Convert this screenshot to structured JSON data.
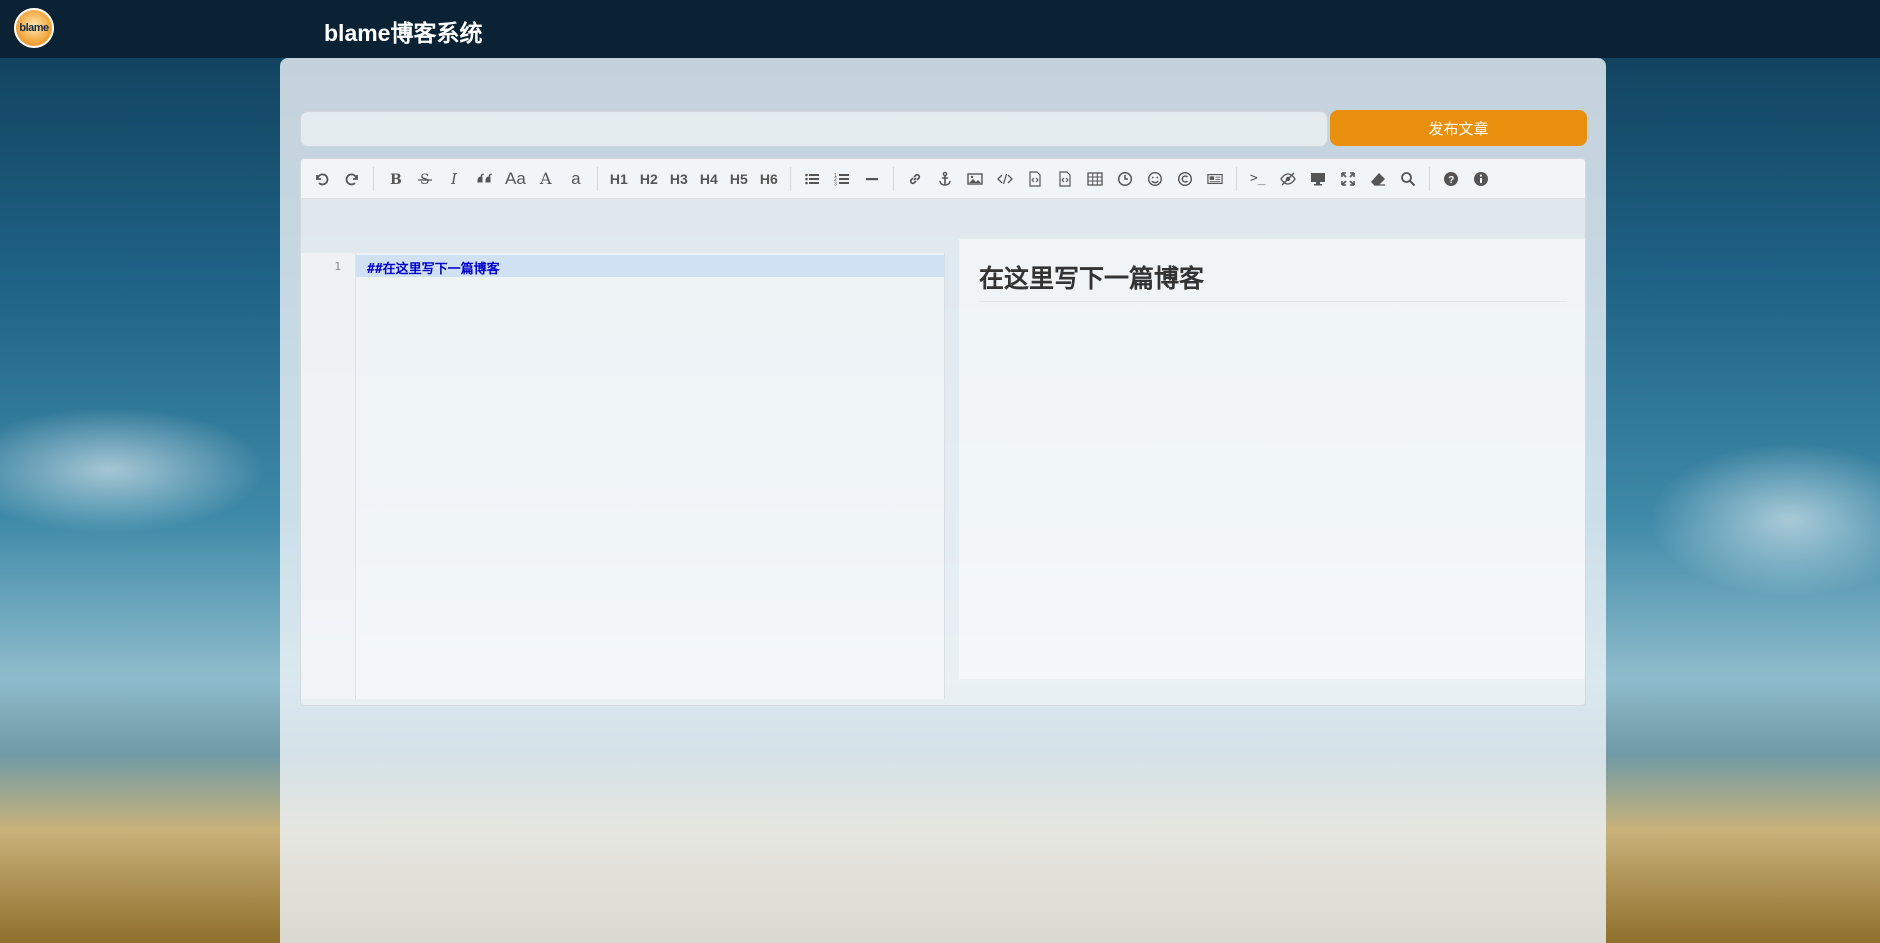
{
  "site": {
    "logo_text": "blame",
    "title": "blame博客系统"
  },
  "form": {
    "title_value": "",
    "publish_label": "发布文章"
  },
  "toolbar": {
    "groups": [
      [
        "undo-icon",
        "redo-icon"
      ],
      [
        "bold-icon",
        "strikethrough-icon",
        "italic-icon",
        "quote-icon",
        "uppercase-icon",
        "uppercase-first-icon",
        "lowercase-icon"
      ],
      [
        "H1",
        "H2",
        "H3",
        "H4",
        "H5",
        "H6"
      ],
      [
        "unordered-list-icon",
        "ordered-list-icon",
        "horizontal-rule-icon"
      ],
      [
        "link-icon",
        "anchor-icon",
        "image-icon",
        "code-icon",
        "preformatted-code-icon",
        "code-block-icon",
        "table-icon",
        "datetime-icon",
        "emoji-icon",
        "html-entities-icon",
        "pagebreak-icon"
      ],
      [
        "goto-line-icon",
        "watch-icon",
        "preview-icon",
        "fullscreen-icon",
        "clear-icon",
        "search-icon"
      ],
      [
        "help-icon",
        "info-icon"
      ]
    ],
    "heading_labels": [
      "H1",
      "H2",
      "H3",
      "H4",
      "H5",
      "H6"
    ],
    "aa_label": "Aa",
    "a_upper_label": "A",
    "a_lower_label": "a",
    "goto_label": ">_"
  },
  "editor": {
    "line_number": "1",
    "code_text": "##在这里写下一篇博客"
  },
  "preview": {
    "heading": "在这里写下一篇博客"
  },
  "colors": {
    "publish": "#e8900d",
    "topbar": "#0a2233",
    "code_text": "#0000cc"
  }
}
